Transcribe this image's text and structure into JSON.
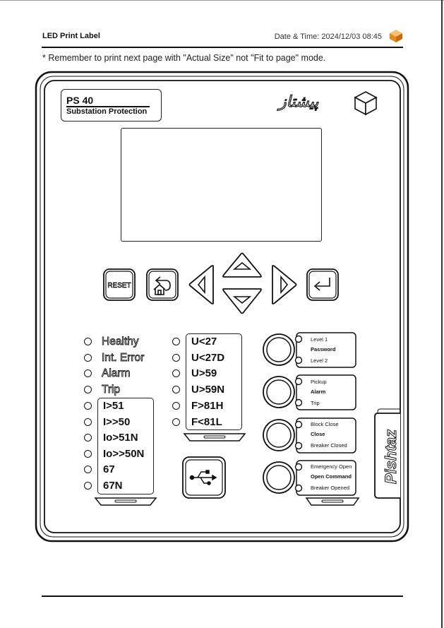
{
  "header": {
    "title": "LED Print Label",
    "date_time": "Date & Time: 2024/12/03 08:45",
    "logo_icon": "orange-cube-logo-icon"
  },
  "note": "* Remember to print next page with \"Actual Size\" not \"Fit to page\" mode.",
  "device": {
    "model": "PS 40",
    "subtitle": "Substation Protection",
    "brand": "پیشتاز",
    "side_brand": "Pishtaz",
    "buttons": {
      "reset": "RESET"
    },
    "status_leds": [
      "Healthy",
      "Int. Error",
      "Alarm",
      "Trip"
    ],
    "current_leds": [
      "I>51",
      "I>>50",
      "Io>51N",
      "Io>>50N",
      "67",
      "67N"
    ],
    "voltage_leds": [
      "U<27",
      "U<27D",
      "U>59",
      "U>59N",
      "F>81H",
      "F<81L"
    ],
    "function_keys": [
      {
        "top": "Level 1",
        "middle": "Password",
        "bottom": "Level 2"
      },
      {
        "top": "Pickup",
        "middle": "Alarm",
        "bottom": "Trip"
      },
      {
        "top": "Block Close",
        "middle": "Close",
        "bottom": "Breaker Closed"
      },
      {
        "top": "Emergency Open",
        "middle": "Open Command",
        "bottom": "Breaker Opened"
      }
    ]
  },
  "colors": {
    "line": "#111111",
    "logo_orange": "#f0a030"
  }
}
